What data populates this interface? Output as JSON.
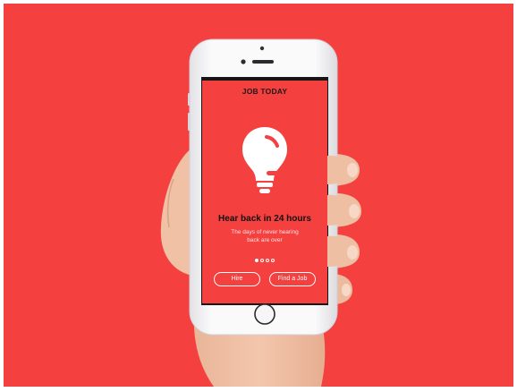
{
  "colors": {
    "background": "#f4403f",
    "phone": "#f4f4f6",
    "skin": "#f1c3a8",
    "text_dark": "#111111",
    "text_light": "#ffffff"
  },
  "app": {
    "title": "JOB TODAY",
    "hero_icon": "lightbulb-icon",
    "headline": "Hear back in 24 hours",
    "subtext_line1": "The days of never hearing",
    "subtext_line2": "back are over",
    "pagination": {
      "total": 4,
      "active": 1
    },
    "buttons": {
      "hire": "Hire",
      "find_job": "Find a Job"
    }
  }
}
